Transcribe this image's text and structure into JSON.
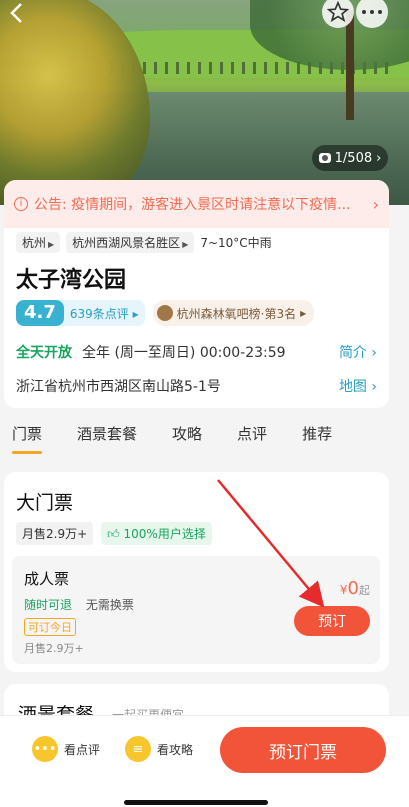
{
  "header": {
    "photo_counter": "1/508"
  },
  "notice": {
    "text": "公告: 疫情期间，游客进入景区时请注意以下疫情..."
  },
  "tags": {
    "city": "杭州",
    "area": "杭州西湖风景名胜区",
    "weather": "7~10°C中雨"
  },
  "title": "太子湾公园",
  "rating": {
    "score": "4.7",
    "reviews": "639条点评",
    "rank": "杭州森林氧吧榜·第3名"
  },
  "hours": {
    "status": "全天开放",
    "detail": "全年 (周一至周日) 00:00-23:59",
    "link": "简介"
  },
  "address": {
    "text": "浙江省杭州市西湖区南山路5-1号",
    "link": "地图"
  },
  "tabs": [
    "门票",
    "酒景套餐",
    "攻略",
    "点评",
    "推荐"
  ],
  "ticket_section": {
    "title": "大门票",
    "sold": "月售2.9万+",
    "pick": "100%用户选择",
    "item": {
      "name": "成人票",
      "feature1": "随时可退",
      "feature2": "无需换票",
      "today": "可订今日",
      "sold": "月售2.9万+",
      "currency": "¥",
      "price": "0",
      "unit": "起",
      "book": "预订"
    }
  },
  "hotel_section": {
    "title": "酒景套餐",
    "subtitle": "一起买更便宜"
  },
  "bottom_bar": {
    "review": "看点评",
    "guide": "看攻略",
    "book": "预订门票"
  },
  "colors": {
    "accent_orange": "#f2543a",
    "teal": "#39b2d2",
    "green": "#19a55e",
    "tab_underline": "#f5a623"
  }
}
